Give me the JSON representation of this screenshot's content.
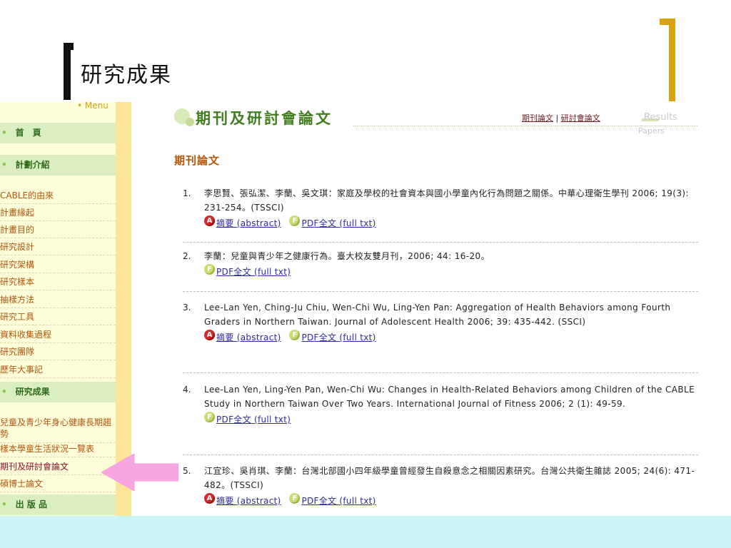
{
  "slide": {
    "title": "研究成果"
  },
  "sidebar": {
    "menu_label": "• Menu",
    "sections": [
      {
        "label": "首　頁",
        "bullet": "•"
      },
      {
        "label": "計劃介紹",
        "bullet": "•"
      },
      {
        "label": "研究成果",
        "bullet": "•"
      },
      {
        "label": "出 版 品",
        "bullet": "•"
      }
    ],
    "items": [
      "CABLE的由來",
      "計畫緣起",
      "計畫目的",
      "研究設計",
      "研究架構",
      "研究樣本",
      "抽樣方法",
      "研究工具",
      "資料收集過程",
      "研究團隊",
      "歷年大事記"
    ],
    "results_items": [
      "兒童及青少年身心健康長期趨勢",
      "樣本學童生活狀況一覽表",
      "期刊及研討會論文",
      "碩博士論文"
    ]
  },
  "content": {
    "title": "期刊及研討會論文",
    "tab_journal": "期刊論文",
    "tab_separator": " | ",
    "tab_conference": "研討會論文",
    "results_label": "Results",
    "papers_label": "Papers",
    "section_heading": "期刊論文",
    "badge_a": "A",
    "badge_f": "F",
    "abstract_label": "摘要 (abstract)",
    "pdf_label": "PDF全文 (full txt)",
    "entries": [
      {
        "num": "1.",
        "text": "李思賢、張弘潔、李蘭、吳文琪：家庭及學校的社會資本與國小學童內化行為問題之關係。中華心理衛生學刊 2006; 19(3): 231-254。(TSSCI)"
      },
      {
        "num": "2.",
        "text": "李蘭：兒童與青少年之健康行為。臺大校友雙月刊，2006; 44: 16-20。"
      },
      {
        "num": "3.",
        "text": "Lee-Lan Yen, Ching-Ju Chiu, Wen-Chi Wu, Ling-Yen Pan: Aggregation of Health Behaviors among Fourth Graders in Northern Taiwan. Journal of Adolescent Health 2006; 39: 435-442. (SSCI)"
      },
      {
        "num": "4.",
        "text": "Lee-Lan Yen, Ling-Yen Pan, Wen-Chi Wu: Changes in Health-Related Behaviors among Children of the CABLE Study in Northern Taiwan Over Two Years. International Journal of Fitness 2006; 2 (1): 49-59."
      },
      {
        "num": "5.",
        "text": "江宜珍、吳肖琪、李蘭：台灣北部國小四年級學童曾經發生自殺意念之相關因素研究。台灣公共衛生雜誌 2005; 24(6): 471-482。(TSSCI)"
      }
    ]
  },
  "colors": {
    "accent_green": "#3f7d1f",
    "sidebar_bg": "#fefeda",
    "arrow_pink": "#f7a6e0",
    "bottom_band": "#cdf4f6",
    "right_bracket": "#d9a20f"
  }
}
